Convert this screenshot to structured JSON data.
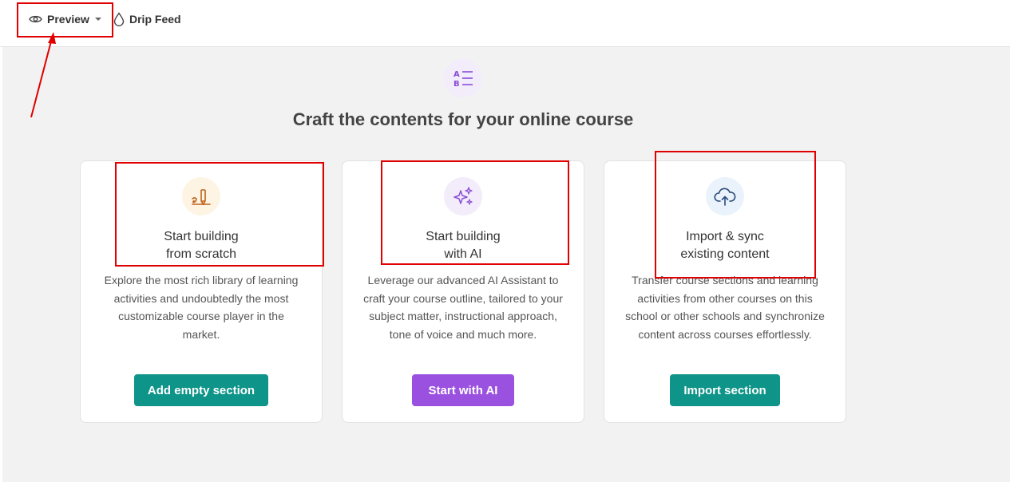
{
  "toolbar": {
    "preview_label": "Preview",
    "drip_feed_label": "Drip Feed"
  },
  "main": {
    "title": "Craft the contents for your online course"
  },
  "cards": [
    {
      "title_line1": "Start building",
      "title_line2": "from scratch",
      "description": "Explore the most rich library of learning activities and undoubtedly the most customizable course player in the market.",
      "button_label": "Add empty section"
    },
    {
      "title_line1": "Start building",
      "title_line2": "with AI",
      "description": "Leverage our advanced AI Assistant to craft your course outline, tailored to your subject matter, instructional approach, tone of voice and much more.",
      "button_label": "Start with AI"
    },
    {
      "title_line1": "Import & sync",
      "title_line2": "existing content",
      "description": "Transfer course sections and learning activities from other courses on this school or other schools and synchronize content across courses effortlessly.",
      "button_label": "Import section"
    }
  ],
  "icons": {
    "preview": "eye-icon",
    "preview_caret": "caret-down-icon",
    "drip_feed": "drop-icon",
    "hero": "list-ab-icon",
    "card1": "pen-scratch-icon",
    "card2": "sparkles-icon",
    "card3": "cloud-upload-icon"
  },
  "colors": {
    "teal_button": "#0e9488",
    "purple_button": "#9b51e0",
    "highlight": "#e00000"
  }
}
